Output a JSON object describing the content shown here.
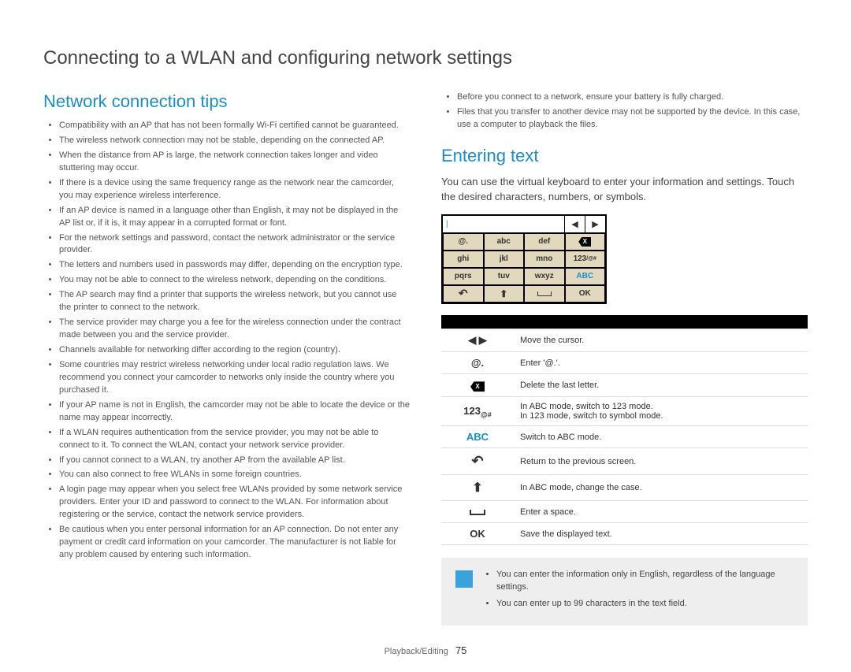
{
  "page_title": "Connecting to a WLAN and configuring network settings",
  "left": {
    "heading": "Network connection tips",
    "tips": [
      "Compatibility with an AP that has not been formally Wi-Fi certified cannot be guaranteed.",
      "The wireless network connection may not be stable, depending on the connected AP.",
      "When the distance from AP is large, the network connection takes longer and video stuttering may occur.",
      "If there is a device using the same frequency range as the network near the camcorder, you may experience wireless interference.",
      "If an AP device is named in a language other than English, it may not be displayed in the AP list or, if it is, it may appear in a corrupted format or font.",
      "For the network settings and password, contact the network administrator or the service provider.",
      "The letters and numbers used in passwords may differ, depending on the encryption type.",
      "You may not be able to connect to the wireless network, depending on the conditions.",
      "The AP search may find a printer that supports the wireless network, but you cannot use the printer to connect to the network.",
      "The service provider may charge you a fee for the wireless connection under the contract made between you and the service provider.",
      "Channels available for networking differ according to the region (country).",
      "Some countries may restrict wireless networking under local radio regulation laws. We recommend you connect your camcorder to networks only inside the country where you purchased it.",
      "If your AP name is not in English, the camcorder may not be able to locate the device or the name may appear incorrectly.",
      "If a WLAN requires authentication from the service provider, you may not be able to connect to it. To connect the WLAN, contact your network service provider.",
      "If you cannot connect to a WLAN, try another AP from the available AP list.",
      "You can also connect to free WLANs in some foreign countries.",
      "A login page may appear when you select free WLANs provided by some network service providers. Enter your ID and password to connect to the WLAN. For information about registering or the service, contact the network service providers.",
      "Be cautious when you enter personal information for an AP connection. Do not enter any payment or credit card information on your camcorder. The manufacturer is not liable for any problem caused by entering such information."
    ]
  },
  "right": {
    "top_notes": [
      "Before you connect to a network, ensure your battery is fully charged.",
      "Files that you transfer to another device may not be supported by the device. In this case, use a computer to playback the files."
    ],
    "heading": "Entering text",
    "intro": "You can use the virtual keyboard to enter your information and settings. Touch the desired characters, numbers, or symbols.",
    "keypad": {
      "cursor": "|",
      "nav_left": "◀",
      "nav_right": "▶",
      "rows": [
        [
          "@.",
          "abc",
          "def",
          "bksp"
        ],
        [
          "ghi",
          "jkl",
          "mno",
          "123/@#"
        ],
        [
          "pqrs",
          "tuv",
          "wxyz",
          "ABC"
        ],
        [
          "back",
          "shift",
          "space",
          "OK"
        ]
      ]
    },
    "icon_table": [
      {
        "icon": "cursor",
        "label": "◀  ▶",
        "desc": "Move the cursor."
      },
      {
        "icon": "at",
        "label": "@.",
        "desc": "Enter '@.'."
      },
      {
        "icon": "bksp",
        "label": "",
        "desc": "Delete the last letter."
      },
      {
        "icon": "mode",
        "label": "123",
        "sub": "@#",
        "desc": "In ABC mode, switch to 123 mode.\nIn 123 mode, switch to symbol mode."
      },
      {
        "icon": "abc",
        "label": "ABC",
        "desc": "Switch to ABC mode."
      },
      {
        "icon": "back",
        "label": "↶",
        "desc": "Return to the previous screen."
      },
      {
        "icon": "shift",
        "label": "⬆",
        "desc": "In ABC mode, change the case."
      },
      {
        "icon": "space",
        "label": "",
        "desc": "Enter a space."
      },
      {
        "icon": "ok",
        "label": "OK",
        "desc": "Save the displayed text."
      }
    ],
    "note_box": [
      "You can enter the information only in English, regardless of the language settings.",
      "You can enter up to 99 characters in the text field."
    ]
  },
  "footer": {
    "section": "Playback/Editing",
    "page": "75"
  }
}
